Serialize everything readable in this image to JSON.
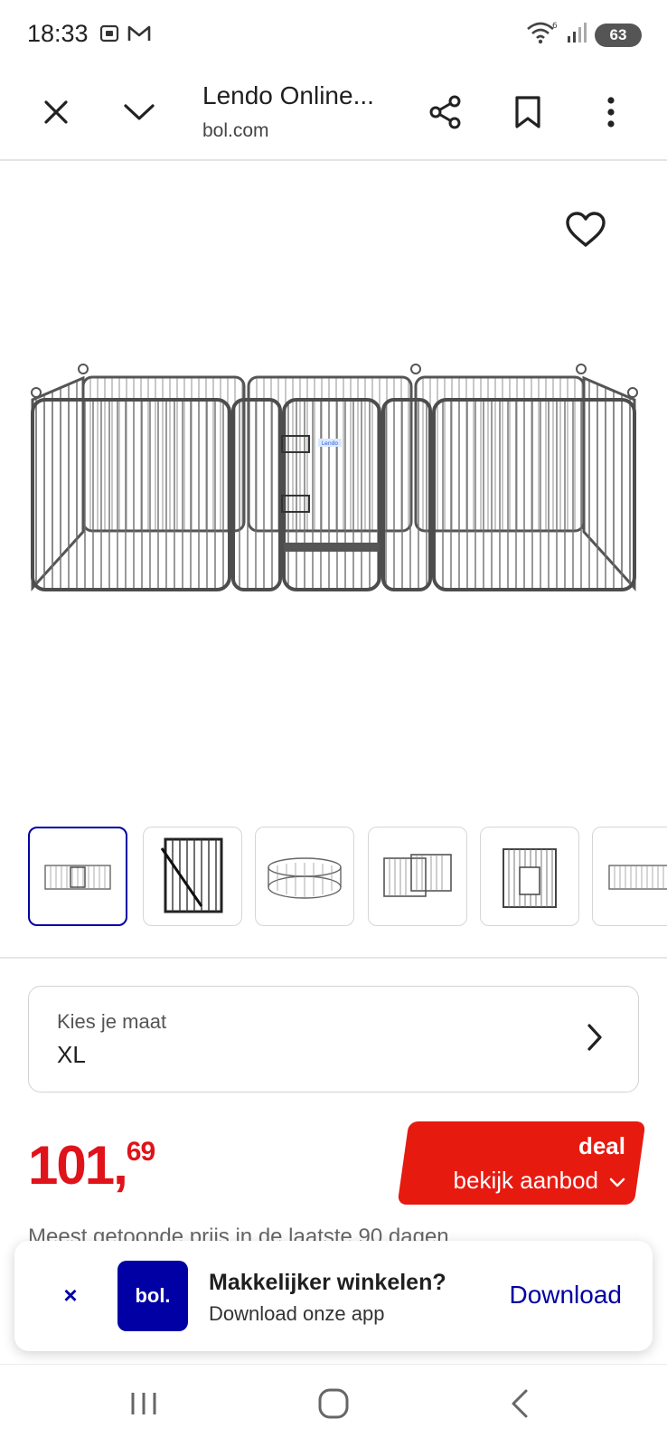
{
  "status_bar": {
    "time": "18:33",
    "battery": "63",
    "icons": [
      "screenshot-icon",
      "gmail-icon",
      "wifi-icon",
      "signal-icon",
      "battery-icon"
    ]
  },
  "toolbar": {
    "title": "Lendo Online...",
    "domain": "bol.com",
    "icons": [
      "close-icon",
      "chevron-down-icon",
      "share-icon",
      "bookmark-icon",
      "more-vert-icon"
    ]
  },
  "product": {
    "image_label": "Lendo",
    "favorite_icon": "heart-icon"
  },
  "thumbnails": [
    {
      "active": true,
      "variant": "wide-pen"
    },
    {
      "active": false,
      "variant": "folded-panels"
    },
    {
      "active": false,
      "variant": "round-pen"
    },
    {
      "active": false,
      "variant": "square-pen"
    },
    {
      "active": false,
      "variant": "tall-pen"
    },
    {
      "active": false,
      "variant": "wide-pen"
    }
  ],
  "size_selector": {
    "label": "Kies je maat",
    "value": "XL"
  },
  "price": {
    "main": "101,",
    "cents": "69",
    "color": "#e0131a",
    "note": "Meest getoonde prijs in de laatste 90 dagen"
  },
  "deal": {
    "title": "deal",
    "subtitle": "bekijk aanbod",
    "color": "#e71a10"
  },
  "app_banner": {
    "close_glyph": "×",
    "logo_text": "bol.",
    "title": "Makkelijker winkelen?",
    "subtitle": "Download onze app",
    "action": "Download",
    "brand_color": "#0000a4"
  },
  "nav_bar": {
    "icons": [
      "recents-icon",
      "home-icon",
      "back-icon"
    ]
  }
}
